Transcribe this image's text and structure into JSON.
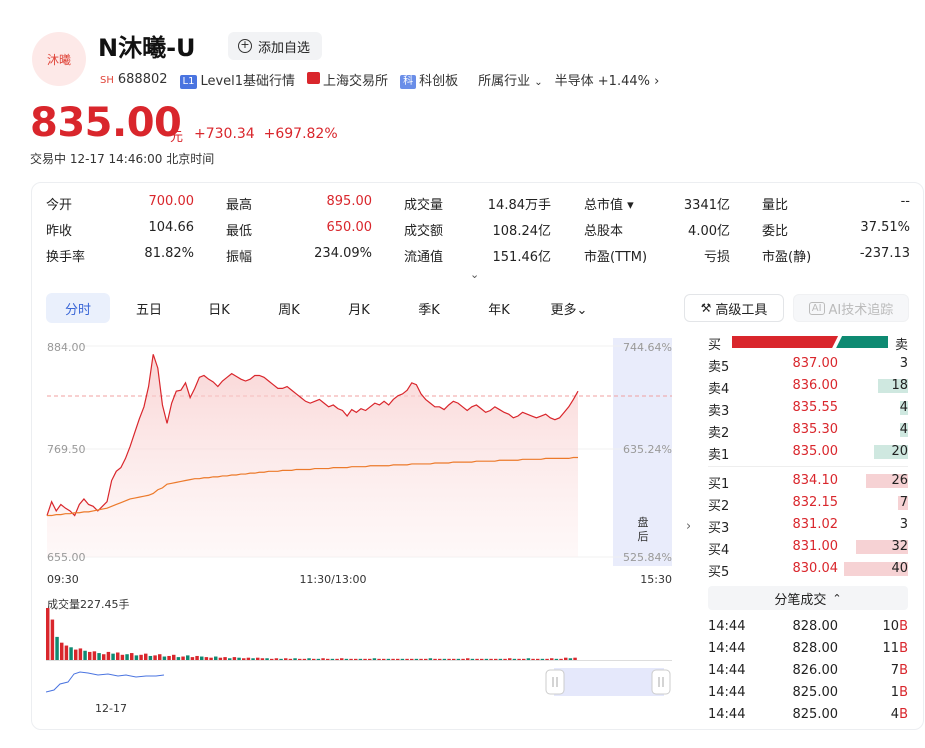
{
  "header": {
    "logo_text": "沐曦",
    "stock_name": "N沐曦-U",
    "add_watchlist_label": "添加自选",
    "market_tag": "SH",
    "code": "688802",
    "level1_badge": "L1",
    "level1_label": "Level1基础行情",
    "exchange_label": "上海交易所",
    "board_badge": "科",
    "board_label": "科创板",
    "industry_label": "所属行业",
    "industry_name": "半导体",
    "industry_change": "+1.44%"
  },
  "quote": {
    "price": "835.00",
    "unit": "元",
    "change": "+730.34",
    "change_pct": "+697.82%",
    "status": "交易中",
    "datetime": "12-17 14:46:00",
    "timezone": "北京时间"
  },
  "metrics": [
    [
      {
        "label": "今开",
        "value": "700.00",
        "color": "red"
      },
      {
        "label": "最高",
        "value": "895.00",
        "color": "red"
      },
      {
        "label": "成交量",
        "value": "14.84万手",
        "color": "black"
      },
      {
        "label": "总市值",
        "value": "3341亿",
        "color": "black",
        "has_dropdown": true
      },
      {
        "label": "量比",
        "value": "--",
        "color": "black"
      }
    ],
    [
      {
        "label": "昨收",
        "value": "104.66",
        "color": "black"
      },
      {
        "label": "最低",
        "value": "650.00",
        "color": "red"
      },
      {
        "label": "成交额",
        "value": "108.24亿",
        "color": "black"
      },
      {
        "label": "总股本",
        "value": "4.00亿",
        "color": "black"
      },
      {
        "label": "委比",
        "value": "37.51%",
        "color": "black"
      }
    ],
    [
      {
        "label": "换手率",
        "value": "81.82%",
        "color": "black"
      },
      {
        "label": "振幅",
        "value": "234.09%",
        "color": "black"
      },
      {
        "label": "流通值",
        "value": "151.46亿",
        "color": "black"
      },
      {
        "label": "市盈(TTM)",
        "value": "亏损",
        "color": "black"
      },
      {
        "label": "市盈(静)",
        "value": "-237.13",
        "color": "black"
      }
    ]
  ],
  "tabs": [
    "分时",
    "五日",
    "日K",
    "周K",
    "月K",
    "季K",
    "年K",
    "更多"
  ],
  "tools": {
    "advanced": "高级工具",
    "ai_tracking": "AI技术追踪"
  },
  "chart_data": {
    "type": "line",
    "y_left_ticks": [
      "884.00",
      "769.50",
      "655.00"
    ],
    "y_right_ticks": [
      "744.64%",
      "635.24%",
      "525.84%"
    ],
    "x_ticks": [
      "09:30",
      "11:30/13:00",
      "15:30"
    ],
    "after_hours_label": "盘后",
    "ylim": [
      655,
      884
    ],
    "prev_close_ref": 835.0,
    "series": [
      {
        "values": [
          700,
          715,
          705,
          712,
          708,
          705,
          700,
          712,
          718,
          712,
          710,
          705,
          710,
          715,
          738,
          748,
          752,
          762,
          775,
          790,
          805,
          818,
          840,
          875,
          860,
          820,
          800,
          822,
          835,
          836,
          844,
          828,
          838,
          850,
          852,
          848,
          845,
          840,
          846,
          850,
          854,
          851,
          848,
          846,
          848,
          852,
          852,
          850,
          846,
          842,
          838,
          838,
          840,
          836,
          832,
          828,
          824,
          822,
          824,
          826,
          822,
          818,
          820,
          816,
          814,
          808,
          815,
          812,
          816,
          814,
          818,
          822,
          820,
          824,
          820,
          826,
          830,
          832,
          836,
          844,
          842,
          832,
          826,
          822,
          818,
          818,
          815,
          820,
          824,
          822,
          818,
          814,
          818,
          820,
          816,
          812,
          814,
          818,
          815,
          812,
          810,
          806,
          808,
          812,
          810,
          808,
          806,
          808,
          810,
          806,
          804,
          806,
          812,
          818,
          826,
          835
        ]
      },
      {
        "values": [
          700,
          700,
          701,
          701,
          702,
          702,
          703,
          703,
          704,
          704,
          705,
          706,
          707,
          708,
          710,
          712,
          714,
          716,
          718,
          719,
          720,
          721,
          722,
          724,
          728,
          730,
          734,
          735,
          736,
          737,
          738,
          739,
          740,
          740,
          741,
          741,
          742,
          742,
          743,
          743,
          744,
          744,
          745,
          745,
          746,
          746,
          747,
          747,
          748,
          748,
          748,
          749,
          749,
          749,
          750,
          750,
          750,
          750,
          751,
          751,
          751,
          751,
          752,
          752,
          752,
          752,
          753,
          753,
          753,
          753,
          754,
          754,
          754,
          754,
          754,
          755,
          755,
          755,
          755,
          756,
          756,
          756,
          756,
          756,
          757,
          757,
          757,
          757,
          758,
          758,
          758,
          758,
          758,
          759,
          759,
          759,
          759,
          759,
          760,
          760,
          760,
          760,
          760,
          761,
          761,
          761,
          761,
          761,
          762,
          762,
          762,
          762,
          762,
          762,
          763,
          763
        ]
      }
    ]
  },
  "volume": {
    "label": "成交量227.45手",
    "date_label": "12-17",
    "bars": [
      {
        "v": 90,
        "c": "r"
      },
      {
        "v": 70,
        "c": "r"
      },
      {
        "v": 40,
        "c": "g"
      },
      {
        "v": 30,
        "c": "r"
      },
      {
        "v": 25,
        "c": "r"
      },
      {
        "v": 22,
        "c": "g"
      },
      {
        "v": 18,
        "c": "r"
      },
      {
        "v": 20,
        "c": "r"
      },
      {
        "v": 16,
        "c": "g"
      },
      {
        "v": 14,
        "c": "r"
      },
      {
        "v": 15,
        "c": "r"
      },
      {
        "v": 12,
        "c": "g"
      },
      {
        "v": 10,
        "c": "r"
      },
      {
        "v": 14,
        "c": "r"
      },
      {
        "v": 11,
        "c": "g"
      },
      {
        "v": 13,
        "c": "r"
      },
      {
        "v": 9,
        "c": "r"
      },
      {
        "v": 10,
        "c": "g"
      },
      {
        "v": 12,
        "c": "r"
      },
      {
        "v": 8,
        "c": "g"
      },
      {
        "v": 9,
        "c": "r"
      },
      {
        "v": 11,
        "c": "r"
      },
      {
        "v": 7,
        "c": "g"
      },
      {
        "v": 8,
        "c": "r"
      },
      {
        "v": 10,
        "c": "r"
      },
      {
        "v": 6,
        "c": "g"
      },
      {
        "v": 7,
        "c": "r"
      },
      {
        "v": 9,
        "c": "r"
      },
      {
        "v": 5,
        "c": "g"
      },
      {
        "v": 6,
        "c": "r"
      },
      {
        "v": 8,
        "c": "g"
      },
      {
        "v": 5,
        "c": "r"
      },
      {
        "v": 7,
        "c": "r"
      },
      {
        "v": 6,
        "c": "g"
      },
      {
        "v": 5,
        "c": "r"
      },
      {
        "v": 4,
        "c": "r"
      },
      {
        "v": 6,
        "c": "g"
      },
      {
        "v": 4,
        "c": "r"
      },
      {
        "v": 5,
        "c": "r"
      },
      {
        "v": 3,
        "c": "g"
      },
      {
        "v": 5,
        "c": "r"
      },
      {
        "v": 4,
        "c": "g"
      },
      {
        "v": 3,
        "c": "r"
      },
      {
        "v": 4,
        "c": "r"
      },
      {
        "v": 3,
        "c": "g"
      },
      {
        "v": 4,
        "c": "r"
      },
      {
        "v": 3,
        "c": "r"
      },
      {
        "v": 3,
        "c": "g"
      },
      {
        "v": 2,
        "c": "r"
      },
      {
        "v": 3,
        "c": "r"
      },
      {
        "v": 2,
        "c": "g"
      },
      {
        "v": 3,
        "c": "r"
      },
      {
        "v": 2,
        "c": "r"
      },
      {
        "v": 3,
        "c": "g"
      },
      {
        "v": 2,
        "c": "r"
      },
      {
        "v": 2,
        "c": "r"
      },
      {
        "v": 3,
        "c": "g"
      },
      {
        "v": 2,
        "c": "r"
      },
      {
        "v": 2,
        "c": "g"
      },
      {
        "v": 3,
        "c": "r"
      },
      {
        "v": 2,
        "c": "r"
      },
      {
        "v": 2,
        "c": "g"
      },
      {
        "v": 2,
        "c": "r"
      },
      {
        "v": 3,
        "c": "r"
      },
      {
        "v": 2,
        "c": "g"
      },
      {
        "v": 2,
        "c": "r"
      },
      {
        "v": 2,
        "c": "r"
      },
      {
        "v": 2,
        "c": "g"
      },
      {
        "v": 2,
        "c": "r"
      },
      {
        "v": 2,
        "c": "r"
      },
      {
        "v": 3,
        "c": "g"
      },
      {
        "v": 2,
        "c": "r"
      },
      {
        "v": 2,
        "c": "r"
      },
      {
        "v": 2,
        "c": "g"
      },
      {
        "v": 2,
        "c": "r"
      },
      {
        "v": 2,
        "c": "r"
      },
      {
        "v": 2,
        "c": "g"
      },
      {
        "v": 2,
        "c": "r"
      },
      {
        "v": 2,
        "c": "r"
      },
      {
        "v": 2,
        "c": "g"
      },
      {
        "v": 2,
        "c": "r"
      },
      {
        "v": 2,
        "c": "r"
      },
      {
        "v": 3,
        "c": "g"
      },
      {
        "v": 2,
        "c": "r"
      },
      {
        "v": 2,
        "c": "r"
      },
      {
        "v": 2,
        "c": "g"
      },
      {
        "v": 2,
        "c": "r"
      },
      {
        "v": 2,
        "c": "r"
      },
      {
        "v": 2,
        "c": "g"
      },
      {
        "v": 2,
        "c": "r"
      },
      {
        "v": 3,
        "c": "r"
      },
      {
        "v": 2,
        "c": "g"
      },
      {
        "v": 2,
        "c": "r"
      },
      {
        "v": 2,
        "c": "r"
      },
      {
        "v": 2,
        "c": "g"
      },
      {
        "v": 2,
        "c": "r"
      },
      {
        "v": 2,
        "c": "r"
      },
      {
        "v": 2,
        "c": "g"
      },
      {
        "v": 2,
        "c": "r"
      },
      {
        "v": 3,
        "c": "r"
      },
      {
        "v": 2,
        "c": "g"
      },
      {
        "v": 2,
        "c": "r"
      },
      {
        "v": 2,
        "c": "r"
      },
      {
        "v": 3,
        "c": "g"
      },
      {
        "v": 2,
        "c": "r"
      },
      {
        "v": 2,
        "c": "r"
      },
      {
        "v": 2,
        "c": "g"
      },
      {
        "v": 2,
        "c": "r"
      },
      {
        "v": 3,
        "c": "r"
      },
      {
        "v": 2,
        "c": "g"
      },
      {
        "v": 2,
        "c": "r"
      },
      {
        "v": 4,
        "c": "r"
      },
      {
        "v": 3,
        "c": "g"
      },
      {
        "v": 4,
        "c": "r"
      }
    ]
  },
  "orderbook": {
    "buy_label": "买",
    "sell_label": "卖",
    "buy_ratio_pct": 68,
    "asks": [
      {
        "label": "卖5",
        "price": "837.00",
        "vol": "3",
        "bar": 0
      },
      {
        "label": "卖4",
        "price": "836.00",
        "vol": "18",
        "bar": 30
      },
      {
        "label": "卖3",
        "price": "835.55",
        "vol": "4",
        "bar": 8
      },
      {
        "label": "卖2",
        "price": "835.30",
        "vol": "4",
        "bar": 8
      },
      {
        "label": "卖1",
        "price": "835.00",
        "vol": "20",
        "bar": 34
      }
    ],
    "bids": [
      {
        "label": "买1",
        "price": "834.10",
        "vol": "26",
        "bar": 42
      },
      {
        "label": "买2",
        "price": "832.15",
        "vol": "7",
        "bar": 10
      },
      {
        "label": "买3",
        "price": "831.02",
        "vol": "3",
        "bar": 0
      },
      {
        "label": "买4",
        "price": "831.00",
        "vol": "32",
        "bar": 52
      },
      {
        "label": "买5",
        "price": "830.04",
        "vol": "40",
        "bar": 64
      }
    ],
    "trades_label": "分笔成交",
    "trades": [
      {
        "time": "14:44",
        "price": "828.00",
        "vol": "10",
        "side": "B"
      },
      {
        "time": "14:44",
        "price": "828.00",
        "vol": "11",
        "side": "B"
      },
      {
        "time": "14:44",
        "price": "826.00",
        "vol": "7",
        "side": "B"
      },
      {
        "time": "14:44",
        "price": "825.00",
        "vol": "1",
        "side": "B"
      },
      {
        "time": "14:44",
        "price": "825.00",
        "vol": "4",
        "side": "B"
      }
    ]
  },
  "colors": {
    "up": "#d9262c",
    "down": "#0e8a72",
    "accent": "#3a66d6",
    "avg_line": "#ec7a2b"
  }
}
